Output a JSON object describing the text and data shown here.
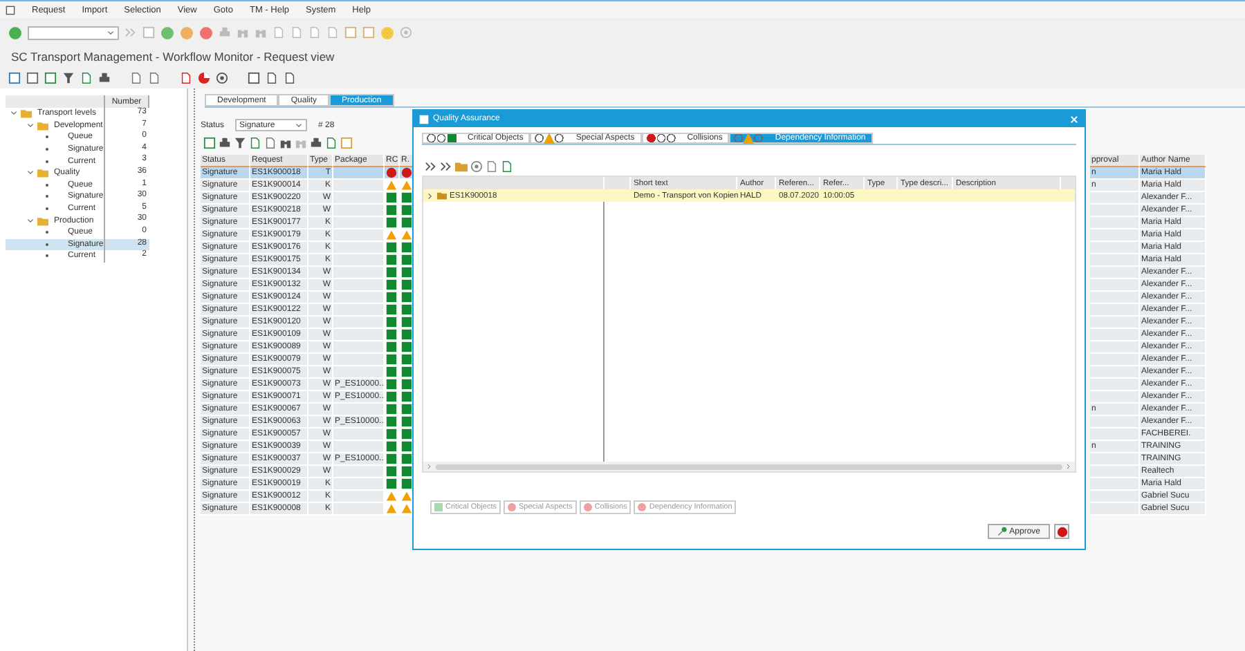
{
  "menu": [
    "Request",
    "Import",
    "Selection",
    "View",
    "Goto",
    "TM - Help",
    "System",
    "Help"
  ],
  "title": "SC Transport Management - Workflow Monitor - Request view",
  "tree": {
    "header": "Number",
    "items": [
      {
        "label": "Transport levels",
        "count": "73",
        "expanded": true,
        "selected": false,
        "children": [
          {
            "label": "Development",
            "count": "7",
            "expanded": true,
            "selected": false,
            "children": [
              {
                "label": "Queue",
                "count": "0",
                "selected": false
              },
              {
                "label": "Signature",
                "count": "4",
                "selected": false
              },
              {
                "label": "Current",
                "count": "3",
                "selected": false
              }
            ]
          },
          {
            "label": "Quality",
            "count": "36",
            "expanded": true,
            "selected": false,
            "children": [
              {
                "label": "Queue",
                "count": "1",
                "selected": false
              },
              {
                "label": "Signature",
                "count": "30",
                "selected": false
              },
              {
                "label": "Current",
                "count": "5",
                "selected": false
              }
            ]
          },
          {
            "label": "Production",
            "count": "30",
            "expanded": true,
            "selected": false,
            "children": [
              {
                "label": "Queue",
                "count": "0",
                "selected": false
              },
              {
                "label": "Signature",
                "count": "28",
                "selected": true
              },
              {
                "label": "Current",
                "count": "2",
                "selected": false
              }
            ]
          }
        ]
      }
    ]
  },
  "tabs": [
    {
      "label": "Development",
      "selected": false
    },
    {
      "label": "Quality",
      "selected": false
    },
    {
      "label": "Production",
      "selected": true
    }
  ],
  "filter": {
    "label": "Status",
    "value": "Signature",
    "count": "# 28"
  },
  "table": {
    "columns": [
      "Status",
      "Request",
      "Type",
      "Package",
      "RC",
      "R.",
      "pproval",
      "Author Name"
    ],
    "rows": [
      {
        "status": "Signature",
        "request": "ES1K900018",
        "type": "T",
        "rc": {
          "color": "#d01818"
        },
        "r": {
          "color": "#d01818"
        },
        "approval": "n",
        "author": "Maria Hald",
        "selected": true
      },
      {
        "status": "Signature",
        "request": "ES1K900014",
        "type": "K",
        "rc": {
          "color": "#f0a000"
        },
        "r": {
          "color": "#f0a000"
        },
        "approval": "n",
        "author": "Maria Hald",
        "selected": false
      },
      {
        "status": "Signature",
        "request": "ES1K900220",
        "type": "W",
        "rc": {
          "color": "#108a30"
        },
        "r": {
          "color": "#108a30"
        },
        "author": "Alexander F...",
        "selected": false
      },
      {
        "status": "Signature",
        "request": "ES1K900218",
        "type": "W",
        "rc": {
          "color": "#108a30"
        },
        "r": {
          "color": "#108a30"
        },
        "author": "Alexander F...",
        "selected": false
      },
      {
        "status": "Signature",
        "request": "ES1K900177",
        "type": "K",
        "rc": {
          "color": "#108a30"
        },
        "r": {
          "color": "#108a30"
        },
        "author": "Maria Hald",
        "selected": false
      },
      {
        "status": "Signature",
        "request": "ES1K900179",
        "type": "K",
        "rc": {
          "color": "#f0a000"
        },
        "r": {
          "color": "#f0a000"
        },
        "author": "Maria Hald",
        "selected": false
      },
      {
        "status": "Signature",
        "request": "ES1K900176",
        "type": "K",
        "rc": {
          "color": "#108a30"
        },
        "r": {
          "color": "#108a30"
        },
        "author": "Maria Hald",
        "selected": false
      },
      {
        "status": "Signature",
        "request": "ES1K900175",
        "type": "K",
        "rc": {
          "color": "#108a30"
        },
        "r": {
          "color": "#108a30"
        },
        "author": "Maria Hald",
        "selected": false
      },
      {
        "status": "Signature",
        "request": "ES1K900134",
        "type": "W",
        "rc": {
          "color": "#108a30"
        },
        "r": {
          "color": "#108a30"
        },
        "author": "Alexander F...",
        "selected": false
      },
      {
        "status": "Signature",
        "request": "ES1K900132",
        "type": "W",
        "rc": {
          "color": "#108a30"
        },
        "r": {
          "color": "#108a30"
        },
        "author": "Alexander F...",
        "selected": false
      },
      {
        "status": "Signature",
        "request": "ES1K900124",
        "type": "W",
        "rc": {
          "color": "#108a30"
        },
        "r": {
          "color": "#108a30"
        },
        "author": "Alexander F...",
        "selected": false
      },
      {
        "status": "Signature",
        "request": "ES1K900122",
        "type": "W",
        "rc": {
          "color": "#108a30"
        },
        "r": {
          "color": "#108a30"
        },
        "author": "Alexander F...",
        "selected": false
      },
      {
        "status": "Signature",
        "request": "ES1K900120",
        "type": "W",
        "rc": {
          "color": "#108a30"
        },
        "r": {
          "color": "#108a30"
        },
        "author": "Alexander F...",
        "selected": false
      },
      {
        "status": "Signature",
        "request": "ES1K900109",
        "type": "W",
        "rc": {
          "color": "#108a30"
        },
        "r": {
          "color": "#108a30"
        },
        "author": "Alexander F...",
        "selected": false
      },
      {
        "status": "Signature",
        "request": "ES1K900089",
        "type": "W",
        "rc": {
          "color": "#108a30"
        },
        "r": {
          "color": "#108a30"
        },
        "author": "Alexander F...",
        "selected": false
      },
      {
        "status": "Signature",
        "request": "ES1K900079",
        "type": "W",
        "rc": {
          "color": "#108a30"
        },
        "r": {
          "color": "#108a30"
        },
        "author": "Alexander F...",
        "selected": false
      },
      {
        "status": "Signature",
        "request": "ES1K900075",
        "type": "W",
        "rc": {
          "color": "#108a30"
        },
        "r": {
          "color": "#108a30"
        },
        "author": "Alexander F...",
        "selected": false
      },
      {
        "status": "Signature",
        "request": "ES1K900073",
        "type": "W",
        "package": "P_ES10000...",
        "rc": {
          "color": "#108a30"
        },
        "r": {
          "color": "#108a30"
        },
        "author": "Alexander F...",
        "selected": false
      },
      {
        "status": "Signature",
        "request": "ES1K900071",
        "type": "W",
        "package": "P_ES10000...",
        "rc": {
          "color": "#108a30"
        },
        "r": {
          "color": "#108a30"
        },
        "author": "Alexander F...",
        "selected": false
      },
      {
        "status": "Signature",
        "request": "ES1K900067",
        "type": "W",
        "rc": {
          "color": "#108a30"
        },
        "r": {
          "color": "#108a30"
        },
        "approval": "n",
        "author": "Alexander F...",
        "selected": false
      },
      {
        "status": "Signature",
        "request": "ES1K900063",
        "type": "W",
        "package": "P_ES10000...",
        "rc": {
          "color": "#108a30"
        },
        "r": {
          "color": "#108a30"
        },
        "author": "Alexander F...",
        "selected": false
      },
      {
        "status": "Signature",
        "request": "ES1K900057",
        "type": "W",
        "rc": {
          "color": "#108a30"
        },
        "r": {
          "color": "#108a30"
        },
        "author": "FACHBEREI.",
        "selected": false
      },
      {
        "status": "Signature",
        "request": "ES1K900039",
        "type": "W",
        "rc": {
          "color": "#108a30"
        },
        "r": {
          "color": "#108a30"
        },
        "approval": "n",
        "author": "TRAINING",
        "selected": false
      },
      {
        "status": "Signature",
        "request": "ES1K900037",
        "type": "W",
        "package": "P_ES10000...",
        "rc": {
          "color": "#108a30"
        },
        "r": {
          "color": "#108a30"
        },
        "author": "TRAINING",
        "selected": false
      },
      {
        "status": "Signature",
        "request": "ES1K900029",
        "type": "W",
        "rc": {
          "color": "#108a30"
        },
        "r": {
          "color": "#108a30"
        },
        "author": "Realtech",
        "selected": false
      },
      {
        "status": "Signature",
        "request": "ES1K900019",
        "type": "K",
        "rc": {
          "color": "#108a30"
        },
        "r": {
          "color": "#108a30"
        },
        "author": "Maria Hald",
        "selected": false
      },
      {
        "status": "Signature",
        "request": "ES1K900012",
        "type": "K",
        "rc": {
          "color": "#f0a000"
        },
        "r": {
          "color": "#f0a000"
        },
        "author": "Gabriel Sucu",
        "selected": false
      },
      {
        "status": "Signature",
        "request": "ES1K900008",
        "type": "K",
        "rc": {
          "color": "#f0a000"
        },
        "r": {
          "color": "#f0a000"
        },
        "author": "Gabriel Sucu",
        "selected": false
      }
    ]
  },
  "dialog": {
    "title": "Quality Assurance",
    "tabs": [
      {
        "label": "Critical Objects",
        "light": {
          "color": "#108a30"
        },
        "selected": false
      },
      {
        "label": "Special Aspects",
        "light": {
          "color": "#f0a000"
        },
        "selected": false
      },
      {
        "label": "Collisions",
        "light": {
          "color": "#d01818"
        },
        "selected": false
      },
      {
        "label": "Dependency Information",
        "light": {
          "color": "#f0a000"
        },
        "selected": true
      }
    ],
    "columns": [
      "Short text",
      "Author",
      "Referen...",
      "Refer...",
      "Type",
      "Type descri...",
      "Description"
    ],
    "rows": [
      {
        "request": "ES1K900018",
        "short_text": "Demo - Transport von Kopien",
        "author": "HALD",
        "date": "08.07.2020",
        "time": "10:00:05",
        "expanded": false
      }
    ],
    "legend": [
      {
        "label": "Critical Objects",
        "color": "#a8d8b0"
      },
      {
        "label": "Special Aspects",
        "color": "#f0a0a0"
      },
      {
        "label": "Collisions",
        "color": "#f0a0a0"
      },
      {
        "label": "Dependency Information",
        "color": "#f0a0a0"
      }
    ],
    "approve": "Approve"
  }
}
